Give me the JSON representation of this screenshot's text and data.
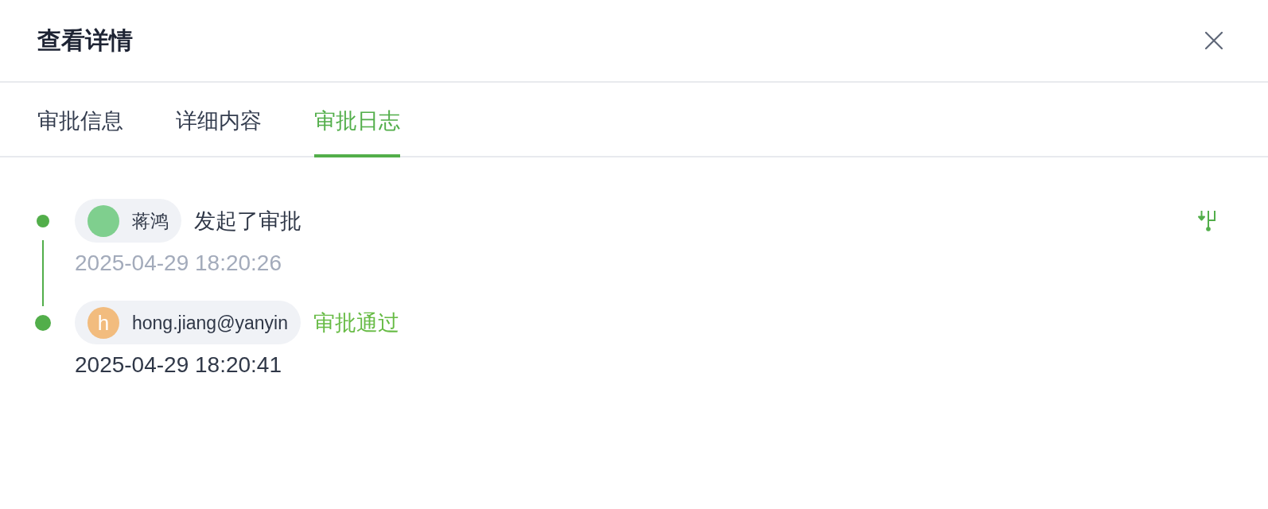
{
  "dialog": {
    "title": "查看详情"
  },
  "tabs": [
    {
      "label": "审批信息",
      "selected": false
    },
    {
      "label": "详细内容",
      "selected": false
    },
    {
      "label": "审批日志",
      "selected": true
    }
  ],
  "log": [
    {
      "kind": "submitted",
      "user": {
        "name": "蒋鸿",
        "color": "#7fcf8e"
      },
      "action": "发起了审批",
      "time": "2025-04-29 18:20:26"
    },
    {
      "kind": "approved",
      "user": {
        "name": "hong.jiang@yanyin",
        "initial": "h",
        "color": "#f2bc7e"
      },
      "action": "审批通过",
      "time": "2025-04-29 18:20:41"
    }
  ]
}
